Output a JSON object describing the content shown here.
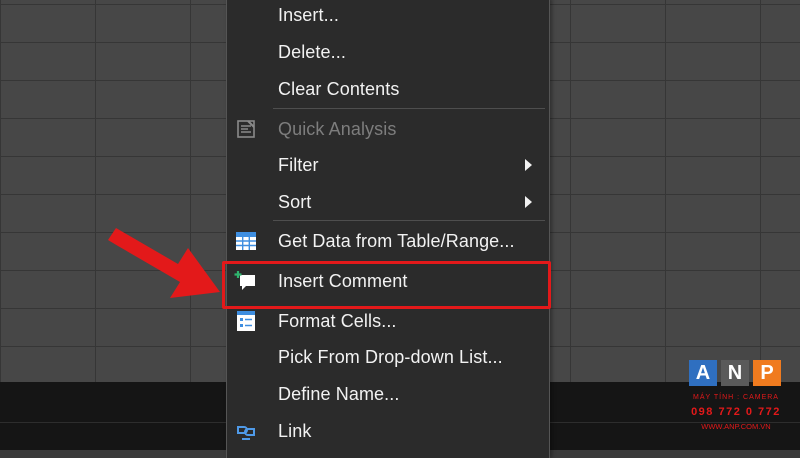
{
  "menu": {
    "items": [
      {
        "label": "Insert...",
        "icon": "",
        "submenu": false,
        "disabled": false
      },
      {
        "label": "Delete...",
        "icon": "",
        "submenu": false,
        "disabled": false
      },
      {
        "label": "Clear Contents",
        "icon": "",
        "submenu": false,
        "disabled": false
      },
      {
        "label": "Quick Analysis",
        "icon": "quick-analysis-icon",
        "submenu": false,
        "disabled": true
      },
      {
        "label": "Filter",
        "icon": "",
        "submenu": true,
        "disabled": false
      },
      {
        "label": "Sort",
        "icon": "",
        "submenu": true,
        "disabled": false
      },
      {
        "label": "Get Data from Table/Range...",
        "icon": "table-icon",
        "submenu": false,
        "disabled": false
      },
      {
        "label": "Insert Comment",
        "icon": "new-comment-icon",
        "submenu": false,
        "disabled": false
      },
      {
        "label": "Format Cells...",
        "icon": "format-cells-icon",
        "submenu": false,
        "disabled": false
      },
      {
        "label": "Pick From Drop-down List...",
        "icon": "",
        "submenu": false,
        "disabled": false
      },
      {
        "label": "Define Name...",
        "icon": "",
        "submenu": false,
        "disabled": false
      },
      {
        "label": "Link",
        "icon": "link-icon",
        "submenu": false,
        "disabled": false
      }
    ],
    "highlighted": "Insert Comment"
  },
  "watermark": {
    "letters": [
      "A",
      "N",
      "P"
    ],
    "tagline": "MÁY TÍNH : CAMERA",
    "phone": "098 772 0 772",
    "website": "WWW.ANP.COM.VN"
  },
  "colors": {
    "menu_bg": "#2b2b2b",
    "annotation_red": "#e3191a",
    "logo_blue": "#2f6fc0",
    "logo_orange": "#f07b1f"
  }
}
